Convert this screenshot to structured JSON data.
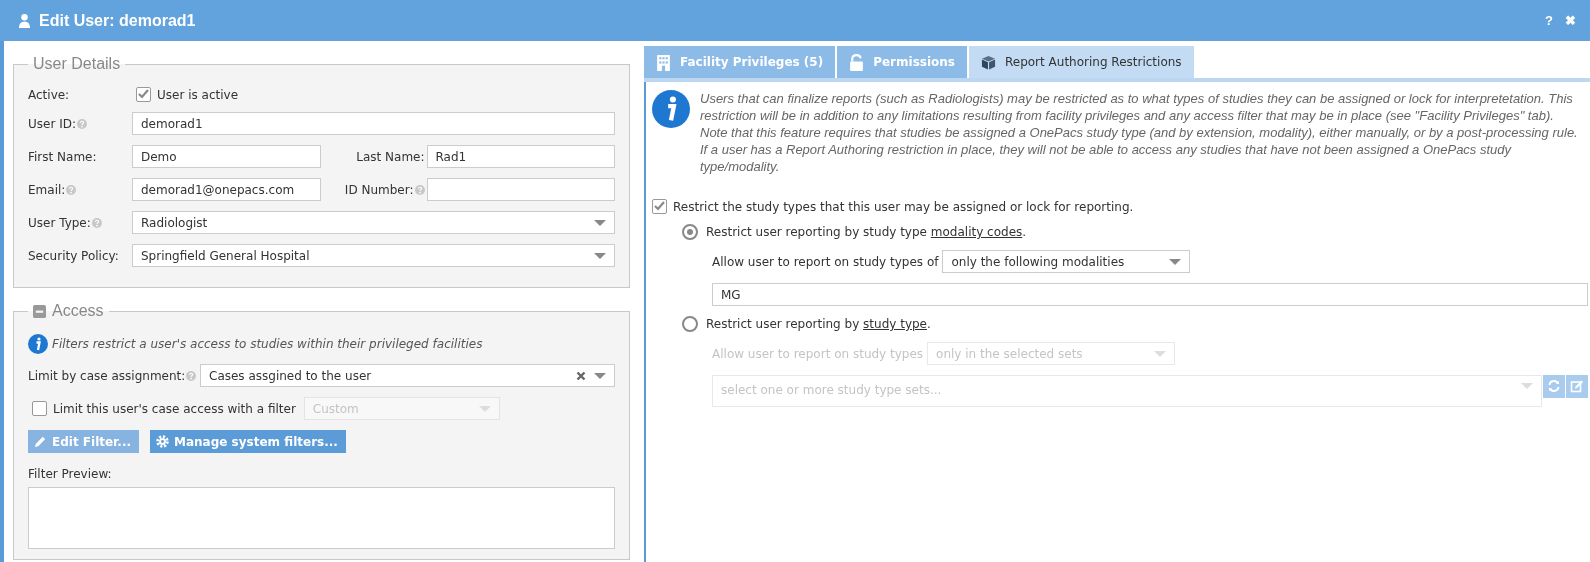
{
  "window": {
    "title": "Edit User: demorad1",
    "help_button": "?",
    "close_button": "✖"
  },
  "user_details": {
    "legend": "User Details",
    "active": {
      "label": "Active:",
      "checkbox_label": "User is active",
      "checked": true
    },
    "rows": [
      {
        "fields": [
          {
            "label": "User ID:",
            "help": true,
            "kind": "text",
            "value": "demorad1"
          }
        ]
      },
      {
        "fields": [
          {
            "label": "First Name:",
            "help": false,
            "kind": "text",
            "value": "Demo"
          },
          {
            "label": "Last Name:",
            "help": false,
            "kind": "text",
            "value": "Rad1"
          }
        ]
      },
      {
        "fields": [
          {
            "label": "Email:",
            "help": true,
            "kind": "text",
            "value": "demorad1@onepacs.com"
          },
          {
            "label": "ID Number:",
            "help": true,
            "kind": "text"
          }
        ]
      },
      {
        "fields": [
          {
            "label": "User Type:",
            "help": true,
            "kind": "select",
            "value": "Radiologist"
          }
        ]
      },
      {
        "fields": [
          {
            "label": "Security Policy:",
            "help": false,
            "kind": "select",
            "value": "Springfield General Hospital"
          }
        ]
      }
    ]
  },
  "access": {
    "legend": "Access",
    "expanded": true,
    "info": "Filters restrict a user's access to studies within their privileged facilities",
    "case_assignment": {
      "label": "Limit by case assignment:",
      "value": "Cases assgined to the user"
    },
    "filter": {
      "label": "Limit this user's case access with a filter",
      "checked": false,
      "value": "Custom"
    },
    "buttons": [
      {
        "label": "Edit Filter...",
        "disabled": true,
        "kind": "edit"
      },
      {
        "label": "Manage system filters...",
        "disabled": false,
        "kind": "manage"
      }
    ],
    "preview_label": "Filter Preview:"
  },
  "tabs": [
    {
      "label": "Facility Privileges (5)",
      "selected": false
    },
    {
      "label": "Permissions",
      "selected": false
    },
    {
      "label": "Report Authoring Restrictions",
      "selected": true
    }
  ],
  "restrictions": {
    "info": "Users that can finalize reports (such as Radiologists) may be restricted as to what types of studies they can be assigned or lock for interpretetation. This restriction will be in addition to any limitations resulting from facility privileges and any access filter that may be in place (see \"Facility Privileges\" tab). Note that this feature requires that studies be assigned a OnePacs study type (and by extension, modality), either manually, or by a post-processing rule. If a user has a Report Authoring restriction in place, they will not be able to access any studies that have not been assigned a OnePacs study type/modality.",
    "restrict": {
      "label": "Restrict the study types that this user may be assigned or lock for reporting.",
      "checked": true
    },
    "options": [
      {
        "before": "Restrict user reporting by study type ",
        "link": "modality codes",
        "after": ".",
        "selected": true,
        "kind": "modality",
        "allow_label": "Allow user to report on study types of",
        "allow_value": "only the following modalities",
        "value": "MG"
      },
      {
        "before": "Restrict user reporting by ",
        "link": "study type",
        "after": ".",
        "selected": false,
        "kind": "study_type",
        "allow_label": "Allow user to report on study types",
        "allow_value": "only in the selected sets",
        "placeholder": "select one or more study type sets..."
      }
    ]
  }
}
